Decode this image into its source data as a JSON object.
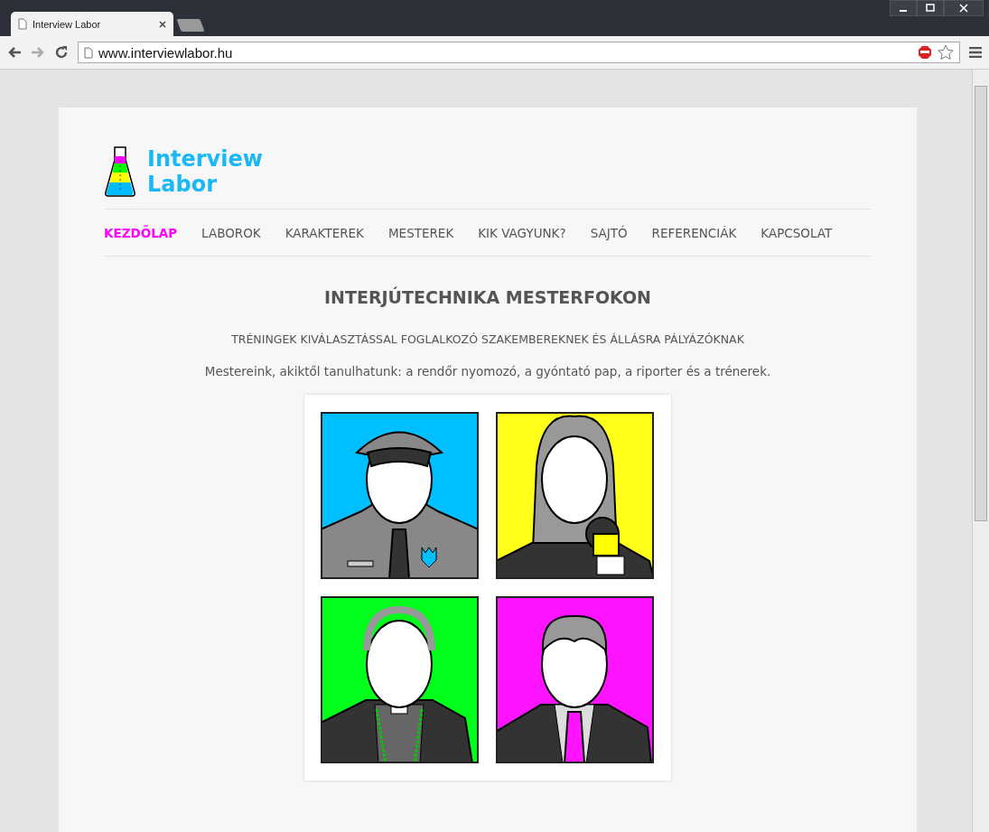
{
  "browser": {
    "tab_title": "Interview Labor",
    "url": "www.interviewlabor.hu"
  },
  "site": {
    "logo_line1": "Interview",
    "logo_line2": "Labor",
    "nav": [
      {
        "label": "KEZDŐLAP",
        "selected": true
      },
      {
        "label": "LABOROK",
        "selected": false
      },
      {
        "label": "KARAKTEREK",
        "selected": false
      },
      {
        "label": "MESTEREK",
        "selected": false
      },
      {
        "label": "KIK VAGYUNK?",
        "selected": false
      },
      {
        "label": "SAJTÓ",
        "selected": false
      },
      {
        "label": "REFERENCIÁK",
        "selected": false
      },
      {
        "label": "KAPCSOLAT",
        "selected": false
      }
    ],
    "heading": "INTERJÚTECHNIKA MESTERFOKON",
    "subheading": "TRÉNINGEK KIVÁLASZTÁSSAL FOGLALKOZÓ SZAKEMBEREKNEK ÉS ÁLLÁSRA PÁLYÁZÓKNAK",
    "intro": "Mestereink, akiktől tanulhatunk: a rendőr nyomozó, a gyóntató pap, a riporter és a trénerek.",
    "portraits": [
      {
        "kind": "police",
        "color": "#00bfff"
      },
      {
        "kind": "reporter",
        "color": "#ffff1a"
      },
      {
        "kind": "priest",
        "color": "#00ff1a"
      },
      {
        "kind": "businessman",
        "color": "#ff14ff"
      }
    ]
  }
}
